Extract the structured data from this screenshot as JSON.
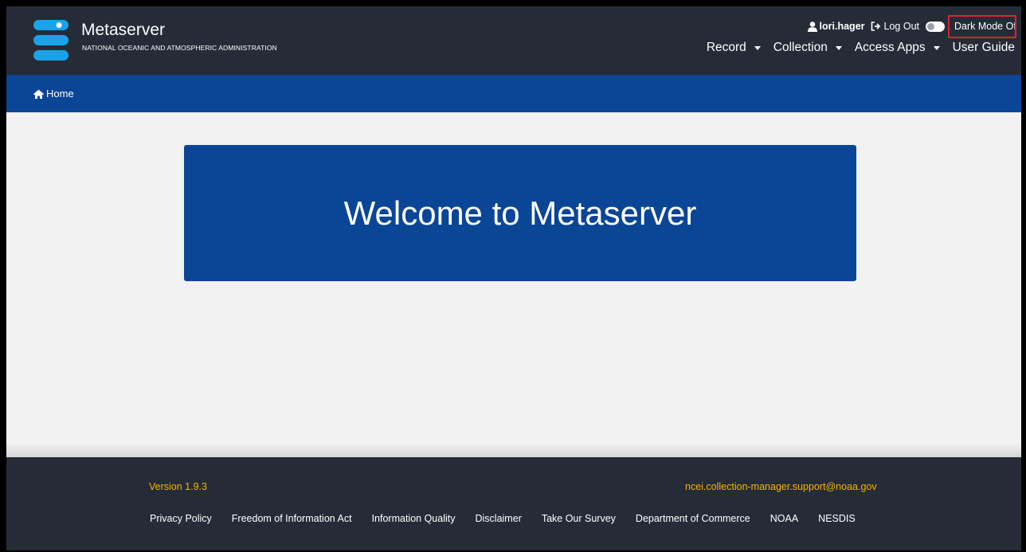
{
  "header": {
    "brand_title": "Metaserver",
    "brand_subtitle": "NATIONAL OCEANIC AND ATMOSPHERIC ADMINISTRATION",
    "username": "lori.hager",
    "logout_label": "Log Out",
    "dark_mode_label": "Dark Mode Off",
    "nav": [
      {
        "label": "Record",
        "icon": "caret-down-icon"
      },
      {
        "label": "Collection",
        "icon": "caret-down-icon"
      },
      {
        "label": "Access Apps",
        "icon": "caret-down-icon"
      },
      {
        "label": "User Guide"
      }
    ]
  },
  "breadcrumb": {
    "home_label": "Home",
    "icon": "home-icon"
  },
  "hero": {
    "title": "Welcome to Metaserver"
  },
  "footer": {
    "version": "Version 1.9.3",
    "support_email": "ncei.collection-manager.support@noaa.gov",
    "links": [
      "Privacy Policy",
      "Freedom of Information Act",
      "Information Quality",
      "Disclaimer",
      "Take Our Survey",
      "Department of Commerce",
      "NOAA",
      "NESDIS"
    ]
  },
  "colors": {
    "header_bg": "#252c38",
    "accent_blue": "#0b4596",
    "logo_blue": "#1aa3e8",
    "footer_highlight": "#f5b400",
    "annotation_red": "#d9232d"
  }
}
